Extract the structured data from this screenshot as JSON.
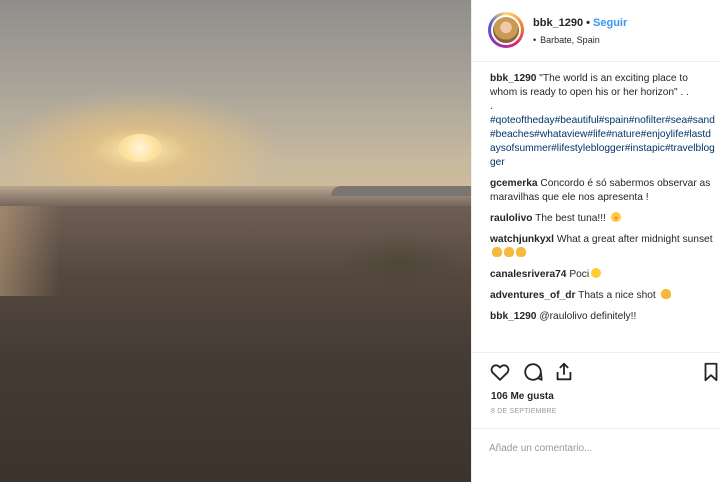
{
  "post": {
    "photo_alt": "Sunset over a sandy beach",
    "header": {
      "username": "bbk_1290",
      "separator": "•",
      "follow_label": "Seguir",
      "location_bullet": "•",
      "location": "Barbate, Spain"
    },
    "caption": {
      "username": "bbk_1290",
      "text": "\"The world is an exciting place to whom is ready to open his or her horizon\" . .",
      "dot": ".",
      "hashtags": "#qoteoftheday#beautiful#spain#nofilter#sea#sand#beaches#whataview#life#nature#enjoylife#lastdaysofsummer#lifestyleblogger#instapic#travelblogger"
    },
    "comments": [
      {
        "username": "gcemerka",
        "text": "Concordo é só sabermos observar as maravilhas que ele nos apresenta !",
        "emoji": []
      },
      {
        "username": "raulolivo",
        "text": "The best tuna!!!",
        "emoji": [
          "blush-emoji"
        ]
      },
      {
        "username": "watchjunkyxl",
        "text": "What a great after midnight sunset",
        "emoji": [
          "clap-emoji",
          "thumbs-up-emoji",
          "clap-emoji"
        ]
      },
      {
        "username": "canalesrivera74",
        "text": "Poci",
        "emoji": [
          "smile-emoji"
        ]
      },
      {
        "username": "adventures_of_dr",
        "text": "Thats a nice shot",
        "emoji": [
          "ok-hand-emoji"
        ]
      },
      {
        "username": "bbk_1290",
        "text": "@raulolivo definitely!!",
        "emoji": []
      }
    ],
    "actions": {
      "icons": [
        "heart-icon",
        "comment-icon",
        "share-icon",
        "bookmark-icon"
      ]
    },
    "likes": "106 Me gusta",
    "date": "8 DE SEPTIEMBRE",
    "add_comment": {
      "placeholder": "Añade un comentario..."
    },
    "colors": {
      "link": "#3897f0",
      "hashtag": "#003569",
      "text": "#262626",
      "muted": "#999999",
      "border": "#efefef"
    }
  }
}
